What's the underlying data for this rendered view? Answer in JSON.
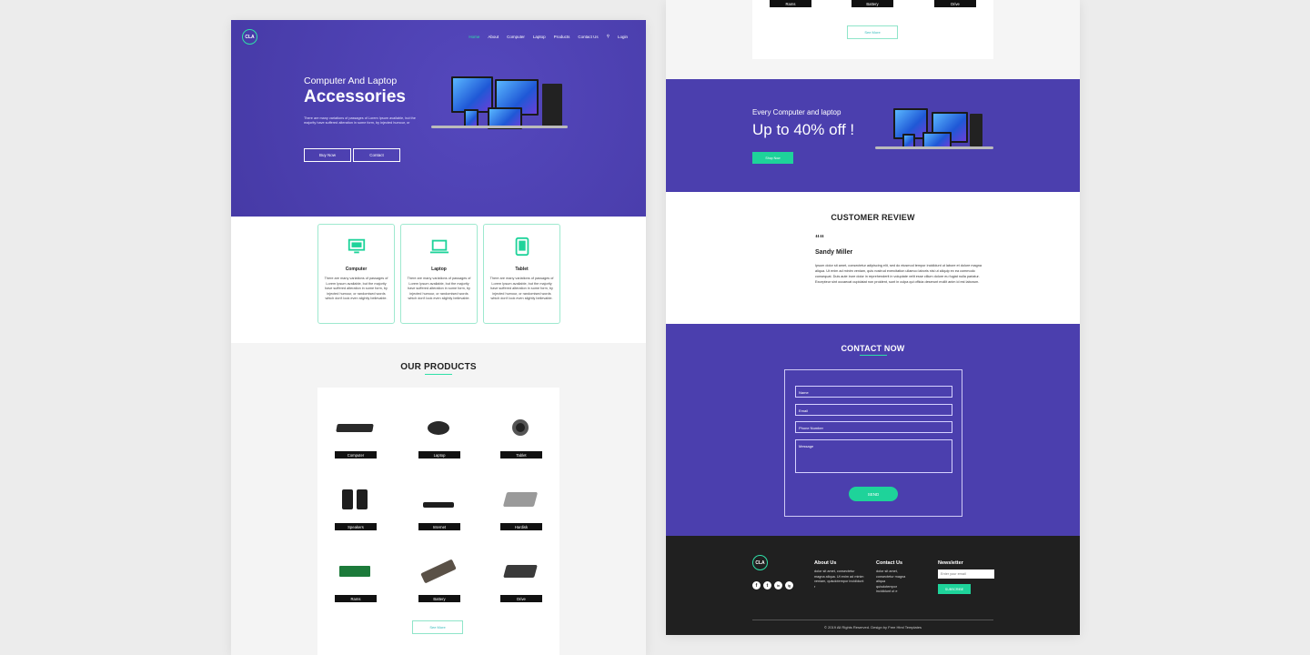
{
  "logo": "CLA",
  "nav": [
    "Home",
    "About",
    "Computer",
    "Laptop",
    "Products",
    "Contact Us",
    "Login"
  ],
  "hero": {
    "subtitle": "Computer And Laptop",
    "title": "Accessories",
    "text": "There are many variations of passages of Lorem Ipsum available, but the majority have suffered alteration in some form, by injected humour, or",
    "btn_buy": "Buy Now",
    "btn_contact": "Contact"
  },
  "features": [
    {
      "title": "Computer",
      "icon": "computer-icon",
      "text": "There are many variations of passages of Lorem Ipsum available, but the majority have suffered alteration in some form, by injected humour, or randomised words which don't look even slightly believable."
    },
    {
      "title": "Laptop",
      "icon": "laptop-icon",
      "text": "There are many variations of passages of Lorem Ipsum available, but the majority have suffered alteration in some form, by injected humour, or randomised words which don't look even slightly believable."
    },
    {
      "title": "Tablet",
      "icon": "tablet-icon",
      "text": "There are many variations of passages of Lorem Ipsum available, but the majority have suffered alteration in some form, by injected humour, or randomised words which don't look even slightly believable."
    }
  ],
  "products": {
    "title": "OUR PRODUCTS",
    "items": [
      "Computer",
      "Laptop",
      "Tablet",
      "Speakers",
      "Internet",
      "Hardisk",
      "Rams",
      "Battery",
      "Drive"
    ],
    "see_more": "See More"
  },
  "right_top": {
    "labels": [
      "Rams",
      "Battery",
      "Drive"
    ],
    "see_more": "See More"
  },
  "offer": {
    "small": "Every Computer and laptop",
    "big": "Up to 40% off !",
    "button": "Shop Now"
  },
  "review": {
    "title": "CUSTOMER REVIEW",
    "quote": "““",
    "name": "Sandy Miller",
    "text": "Ipsum dolor sit amet, consectetur adipiscing elit, sed do eiusmod tempor incididunt ut labore et dolore magna aliqua. Ut enim ad minim veniam, quis nostrud exercitation ullamco laboris nisi ut aliquip ex ea commodo consequat. Duis aute irure dolor in reprehenderit in voluptate velit esse cillum dolore eu fugiat nulla pariatur. Excepteur sint occaecat cupidatat non proident, sunt in culpa qui officia deserunt mollit anim id est laborum."
  },
  "contact": {
    "title": "CONTACT NOW",
    "name": "Name",
    "email": "Email",
    "phone": "Phone Number",
    "message": "Message",
    "send": "SEND"
  },
  "footer": {
    "about_title": "About Us",
    "about_text": "dolor sit amet, consectetur magna aliqua. Ut enim ad minim veniam, quisdotempor incididunt r",
    "contact_title": "Contact Us",
    "contact_text": "dolor sit amet, consectetur magna aliqua quisdotempor incididunt ut e",
    "news_title": "Newsletter",
    "news_placeholder": "Enter your email",
    "subscribe": "SUBSCRIBE",
    "social": [
      "f",
      "t",
      "in",
      "ig"
    ],
    "copyright": "© 2019 All Rights Reserved. Design by Free Html Templates"
  },
  "colors": {
    "accent": "#2fe0a8",
    "brand": "#4b3fae",
    "footer": "#202020"
  }
}
